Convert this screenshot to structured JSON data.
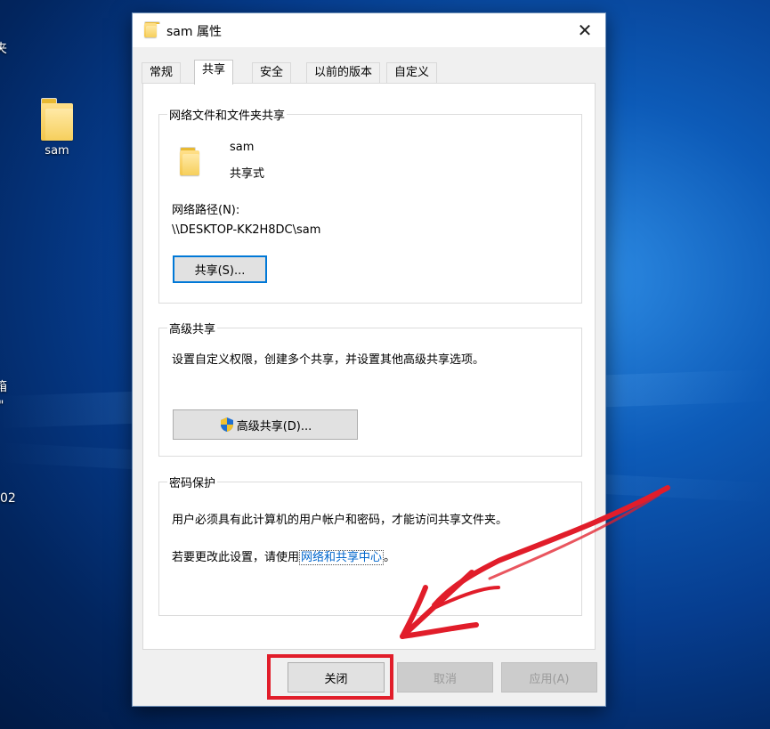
{
  "desktop": {
    "folder_label": "sam",
    "edge_texts": [
      "夹",
      "箱",
      "\"",
      "02"
    ]
  },
  "dialog": {
    "title": "sam 属性",
    "tabs": [
      "常规",
      "共享",
      "安全",
      "以前的版本",
      "自定义"
    ],
    "active_tab": "共享",
    "network_sharing": {
      "legend": "网络文件和文件夹共享",
      "folder_name": "sam",
      "share_status": "共享式",
      "path_label": "网络路径(N):",
      "path_value": "\\\\DESKTOP-KK2H8DC\\sam",
      "share_button": "共享(S)..."
    },
    "advanced_sharing": {
      "legend": "高级共享",
      "description": "设置自定义权限，创建多个共享，并设置其他高级共享选项。",
      "button": "高级共享(D)..."
    },
    "password_protection": {
      "legend": "密码保护",
      "description": "用户必须具有此计算机的用户帐户和密码，才能访问共享文件夹。",
      "change_prefix": "若要更改此设置，请使用",
      "link_text": "网络和共享中心",
      "change_suffix": "。"
    },
    "buttons": {
      "close": "关闭",
      "cancel": "取消",
      "apply": "应用(A)"
    }
  },
  "colors": {
    "annotation_red": "#e11d2a",
    "focus_blue": "#0078d7",
    "link_blue": "#0066cc"
  }
}
